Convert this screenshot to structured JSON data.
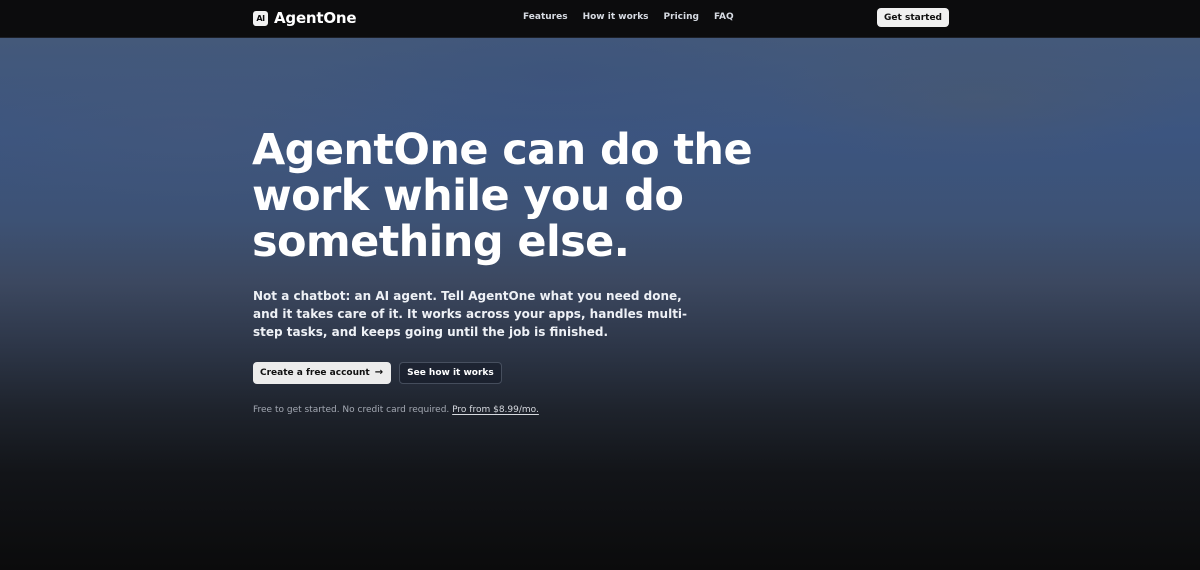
{
  "brand": {
    "logo_text": "AI",
    "name": "AgentOne"
  },
  "nav": {
    "links": [
      "Features",
      "How it works",
      "Pricing",
      "FAQ"
    ],
    "cta": "Get started"
  },
  "hero": {
    "headline": "AgentOne can do the work while you do something else.",
    "subtext": "Not a chatbot: an AI agent. Tell AgentOne what you need done, and it takes care of it. It works across your apps, handles multi-step tasks, and keeps going until the job is finished.",
    "primary_cta": "Create a free account",
    "primary_cta_icon": "arrow-right-icon",
    "secondary_cta": "See how it works",
    "note_text": "Free to get started. No credit card required.",
    "note_link": "Pro from $8.99/mo."
  },
  "colors": {
    "nav_bg": "#0c0c0d",
    "button_light": "#ececec",
    "hero_blue": "#3c5580"
  }
}
